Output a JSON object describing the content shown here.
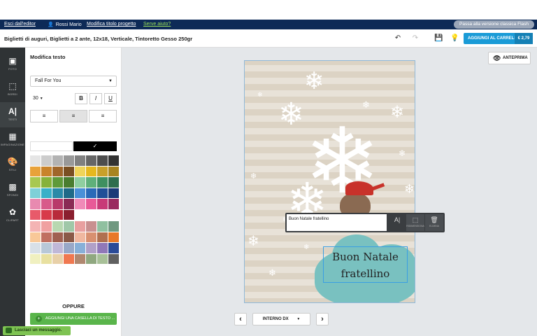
{
  "topbar": {
    "exit": "Esci dall'editor",
    "user": "Rossi Mario",
    "edit_title": "Modifica titolo progetto",
    "help": "Serve aiuto?",
    "flash": "Passa alla versione classica Flash"
  },
  "titlebar": {
    "title": "Biglietti di auguri, Biglietti a 2 ante, 12x18, Verticale, Tintoretto Gesso 250gr",
    "cart_label": "AGGIUNGI AL CARRELLO",
    "cart_price": "€ 2,79"
  },
  "rail": [
    {
      "label": "FOTO",
      "icon": "image-icon"
    },
    {
      "label": "BORDI",
      "icon": "crop-icon"
    },
    {
      "label": "TESTI",
      "icon": "text-icon"
    },
    {
      "label": "IMPAGINAZIONE",
      "icon": "layout-icon"
    },
    {
      "label": "STILI",
      "icon": "palette-icon"
    },
    {
      "label": "SFONDI",
      "icon": "background-icon"
    },
    {
      "label": "CLIPART",
      "icon": "flower-icon"
    }
  ],
  "panel": {
    "title": "Modifica testo",
    "font": "Fall For You",
    "size": "30",
    "bold": "B",
    "italic": "I",
    "underline": "U",
    "oppure": "OPPURE",
    "add_text": "AGGIUNGI UNA CASELLA DI TESTO ..."
  },
  "palette_colors": {
    "swatches": [
      "#e5e5e5",
      "#cccccc",
      "#b3b3b3",
      "#999999",
      "#808080",
      "#666666",
      "#4d4d4d",
      "#333333",
      "#e8a23a",
      "#c9832a",
      "#a0662a",
      "#7a4f22",
      "#f0d45a",
      "#e6b81f",
      "#c9a02a",
      "#a88420",
      "#a8c850",
      "#86b23a",
      "#5f9a3a",
      "#4a7d2f",
      "#8fcfa0",
      "#5fb07a",
      "#3f9060",
      "#2e6e4e",
      "#7fd0d8",
      "#3ab0c8",
      "#2a8aa8",
      "#1f6a88",
      "#4a90d8",
      "#2a6ab8",
      "#1f4f98",
      "#1a3a78",
      "#e88ab0",
      "#d85a8a",
      "#b83a6a",
      "#8a2a55",
      "#f08ab8",
      "#e85a98",
      "#c83a78",
      "#9a2a60",
      "#e85a6a",
      "#d83a4a",
      "#b82a3a",
      "#8a1f2f"
    ],
    "pastels": [
      "#f4b4b4",
      "#f0a0a0",
      "#b8d8b0",
      "#a0c8a8",
      "#e8a0a0",
      "#c89090",
      "#90c0a0",
      "#709880",
      "#f8c898",
      "#c07060",
      "#a06050",
      "#8a5a48",
      "#f0b8a0",
      "#d89070",
      "#b07050",
      "#e87828",
      "#d8e0e8",
      "#b8c8d8",
      "#c0b8d8",
      "#98a8c8",
      "#88b0d8",
      "#b0a0c8",
      "#9078b8",
      "#2a4a98",
      "#f0f0c0",
      "#e8e0a0",
      "#e8d0a8",
      "#f07850",
      "#b08870",
      "#90a880",
      "#a8c098",
      "#606060"
    ]
  },
  "workspace": {
    "preview": "ANTEPRIMA",
    "card_text": "Buon Natale fratellino",
    "page_label": "INTERNO DX"
  },
  "editbar": {
    "input_value": "Buon Natale fratellino",
    "tools": [
      {
        "label": "A|",
        "icon": "text-cursor-icon",
        "caption": ""
      },
      {
        "label": "⬚",
        "icon": "resize-icon",
        "caption": "RIDIMENSIONA"
      },
      {
        "label": "🗑",
        "icon": "trash-icon",
        "caption": "ELIMINA"
      }
    ]
  },
  "chat": {
    "label": "Lasciaci un messaggio."
  }
}
